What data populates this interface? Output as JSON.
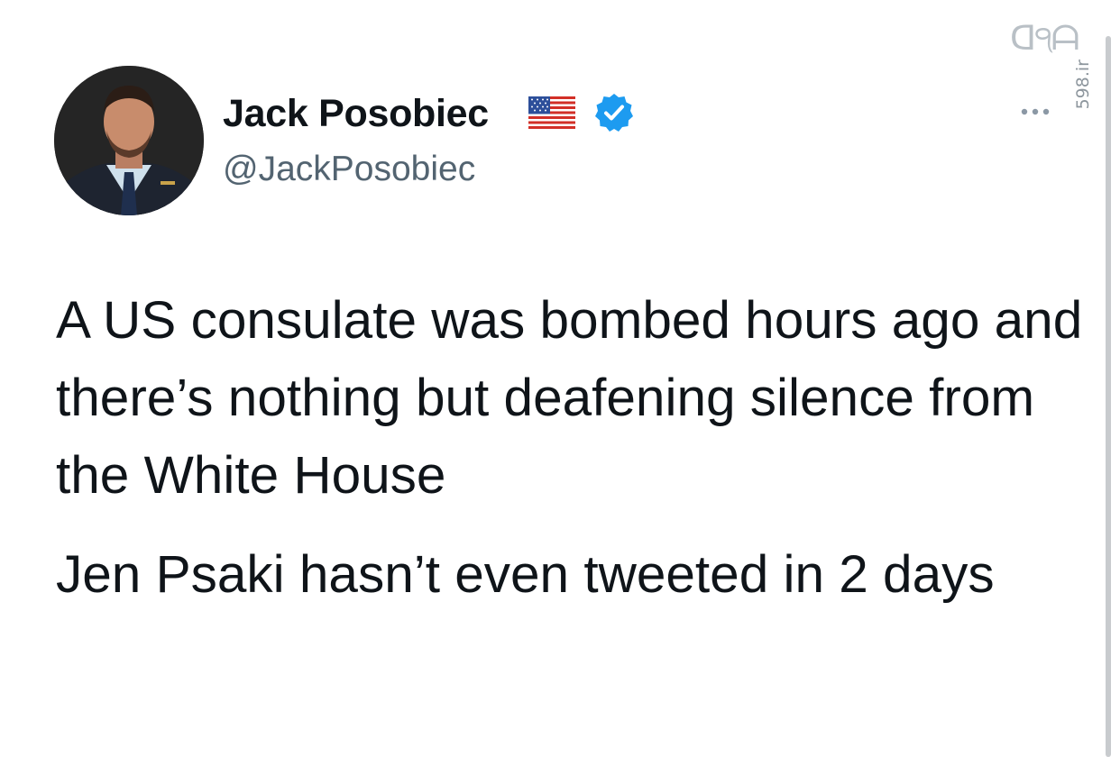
{
  "author": {
    "display_name": "Jack Posobiec",
    "handle": "@JackPosobiec",
    "flag_icon": "us-flag-icon",
    "verified_icon": "verified-badge-icon",
    "verified_color": "#1d9bf0"
  },
  "tweet": {
    "paragraphs": [
      "A US consulate was bombed hours ago and there’s nothing but deafening silence from the White House",
      "Jen Psaki hasn’t even tweeted in 2 days"
    ]
  },
  "more_icon": "more-horizontal-icon",
  "watermark": {
    "logo": "ᗡ੧ᗩ",
    "site": "598.ir"
  }
}
